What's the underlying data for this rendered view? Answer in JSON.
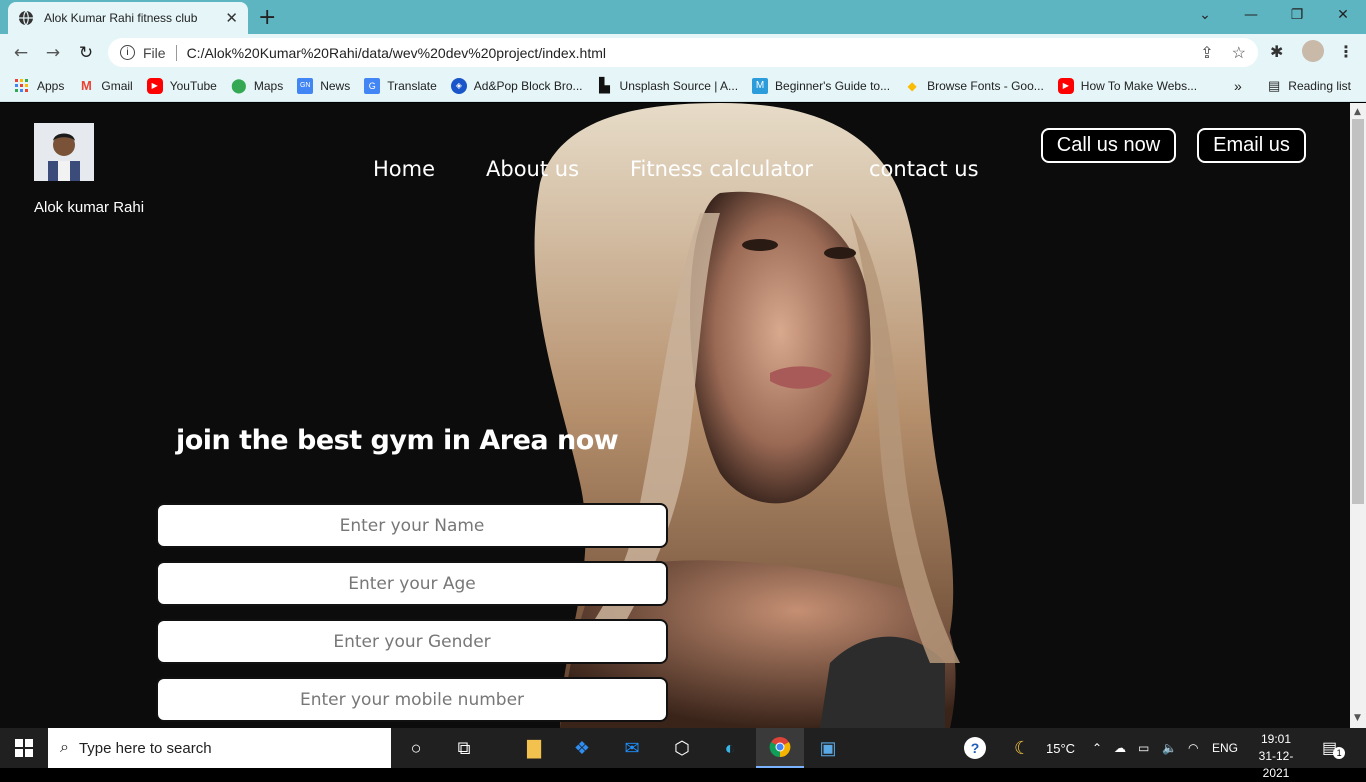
{
  "browser": {
    "tab_title": "Alok Kumar Rahi fitness club",
    "tab_close": "✕",
    "new_tab": "+",
    "window_controls": {
      "chevron": "⌄",
      "minimize": "—",
      "restore": "❐",
      "close": "✕"
    },
    "nav": {
      "back": "←",
      "forward": "→",
      "reload": "↻"
    },
    "address": {
      "info": "i",
      "scheme_label": "File",
      "url": "C:/Alok%20Kumar%20Rahi/data/wev%20dev%20project/index.html"
    },
    "bookmarks": [
      {
        "label": "Apps",
        "icon": "apps-grid-icon",
        "color": "#e94335"
      },
      {
        "label": "Gmail",
        "icon": "gmail-icon",
        "color": "#ea4335"
      },
      {
        "label": "YouTube",
        "icon": "youtube-icon",
        "color": "#ff0000"
      },
      {
        "label": "Maps",
        "icon": "maps-pin-icon",
        "color": "#34a853"
      },
      {
        "label": "News",
        "icon": "news-icon",
        "color": "#4285f4"
      },
      {
        "label": "Translate",
        "icon": "translate-icon",
        "color": "#4285f4"
      },
      {
        "label": "Ad&Pop Block Bro...",
        "icon": "shield-icon",
        "color": "#1a56c9"
      },
      {
        "label": "Unsplash Source | A...",
        "icon": "unsplash-icon",
        "color": "#111111"
      },
      {
        "label": "Beginner's Guide to...",
        "icon": "m-logo-icon",
        "color": "#2d9cdb"
      },
      {
        "label": "Browse Fonts - Goo...",
        "icon": "google-fonts-icon",
        "color": "#fbbc05"
      },
      {
        "label": "How To Make Webs...",
        "icon": "youtube-icon",
        "color": "#ff0000"
      }
    ],
    "bookmarks_more": "»",
    "reading_list": "Reading list"
  },
  "site": {
    "brand_name": "Alok kumar Rahi",
    "nav": [
      "Home",
      "About us",
      "Fitness calculator",
      "contact us"
    ],
    "cta": {
      "call": "Call us now",
      "email": "Email us"
    },
    "headline": "join the best gym in Area now",
    "form": {
      "name_placeholder": "Enter your Name",
      "age_placeholder": "Enter your Age",
      "gender_placeholder": "Enter your Gender",
      "mobile_placeholder": "Enter your mobile number"
    }
  },
  "taskbar": {
    "search_placeholder": "Type here to search",
    "temperature": "15°C",
    "language": "ENG",
    "time": "19:01",
    "date": "31-12-2021",
    "notification_count": "1"
  }
}
